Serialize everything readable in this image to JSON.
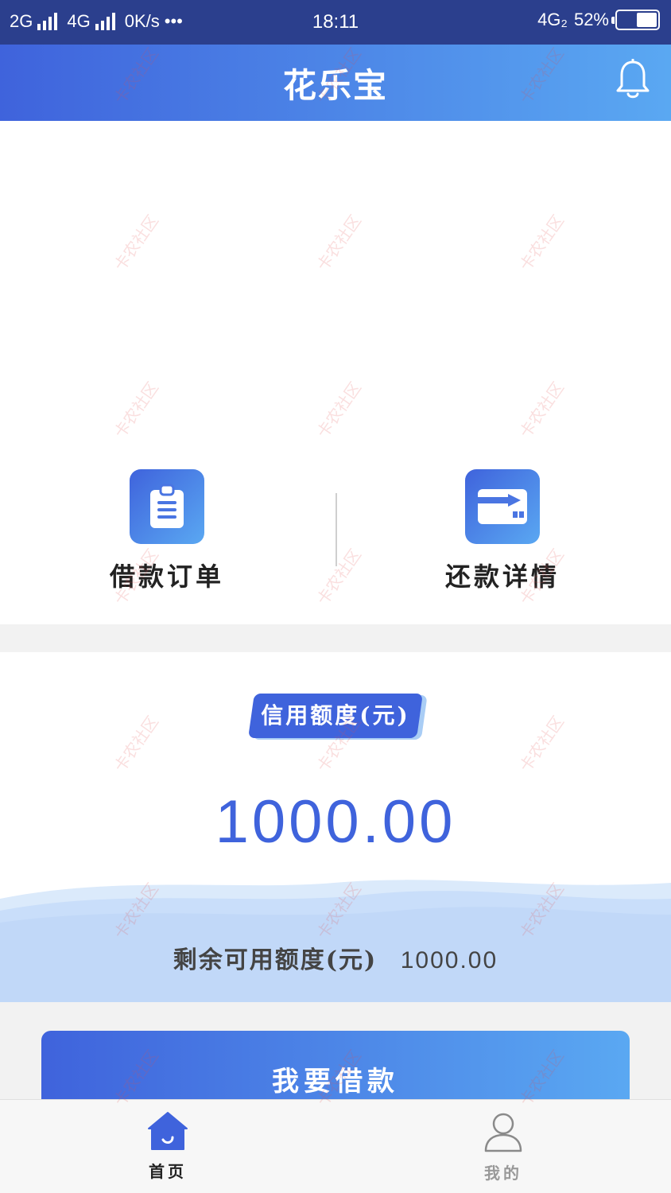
{
  "status_bar": {
    "left_text": "2G",
    "net2": "4G",
    "speed": "0K/s",
    "dots": "•••",
    "time": "18:11",
    "network_right": "4G₂",
    "battery_text": "52%",
    "battery_level": 0.52
  },
  "header": {
    "title": "花乐宝",
    "bell_icon": "bell-icon"
  },
  "actions": [
    {
      "label": "借款订单",
      "icon": "clipboard-icon"
    },
    {
      "label": "还款详情",
      "icon": "card-icon"
    }
  ],
  "credit": {
    "badge": "信用额度(元)",
    "amount": "1000.00",
    "remaining_label": "剩余可用额度(元)",
    "remaining_value": "1000.00"
  },
  "borrow_button": {
    "label": "我要借款"
  },
  "tabs": [
    {
      "label": "首页",
      "icon": "home-icon",
      "active": true
    },
    {
      "label": "我的",
      "icon": "user-icon",
      "active": false
    }
  ],
  "watermark_text": "卡农社区",
  "colors": {
    "accent": "#3f63dc",
    "accent_light": "#5aa8f2",
    "status_bar": "#2b3f8d"
  }
}
